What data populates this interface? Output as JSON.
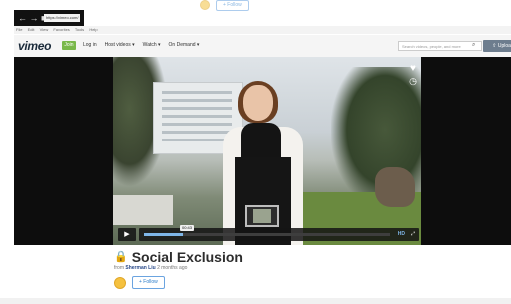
{
  "top_follow": {
    "label": "+ Follow"
  },
  "browser": {
    "nav_glyphs": "← → ■",
    "url": "https://vimeo.com/",
    "menu": [
      "File",
      "Edit",
      "View",
      "Favorites",
      "Tools",
      "Help"
    ]
  },
  "header": {
    "logo": "vimeo",
    "join_label": "Join",
    "nav": {
      "login": "Log in",
      "host_videos": "Host videos ▾",
      "watch": "Watch ▾",
      "on_demand": "On Demand ▾"
    },
    "search_placeholder": "Search videos, people, and more",
    "upload_label": "⇧ Upload"
  },
  "player": {
    "time_bubble": "00:43",
    "progress": 0.16,
    "hd_label": "HD",
    "play_icon": "▶",
    "heart_icon": "♥",
    "clock_icon": "◷",
    "fullscreen_icon": "⤢"
  },
  "video": {
    "title": "Social Exclusion",
    "byline_prefix": "from",
    "author": "Sherman Liu",
    "age": "2 months ago",
    "follow_label": "+ Follow",
    "lock_icon": "🔒"
  }
}
